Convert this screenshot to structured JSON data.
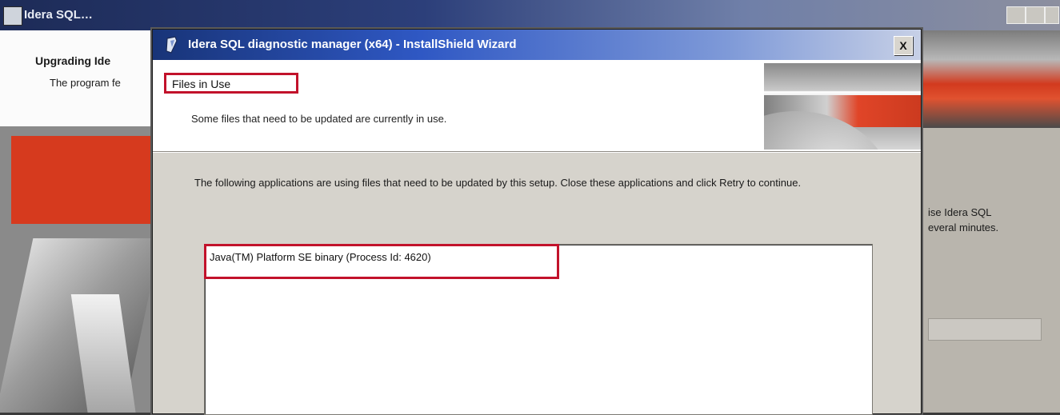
{
  "background_window": {
    "title": "Idera SQL…",
    "header_title": "Upgrading Ide",
    "header_subtitle": "The program fe",
    "right_text_line1": "ise Idera SQL",
    "right_text_line2": "everal minutes.",
    "colors": {
      "titlebar": "#2c3f7a",
      "accent": "#d63a1e"
    }
  },
  "dialog": {
    "title": "Idera SQL diagnostic manager (x64) - InstallShield Wizard",
    "close_label": "X",
    "header": {
      "title": "Files in Use",
      "subtitle": "Some files that need to be updated are currently in use."
    },
    "instructions": "The following applications are using files that need to be updated by this setup. Close these applications and click Retry to continue.",
    "files_in_use": [
      "Java(TM) Platform SE binary (Process Id: 4620)"
    ],
    "colors": {
      "annotation": "#c2122b",
      "titlebar": "#2f58c4"
    }
  }
}
